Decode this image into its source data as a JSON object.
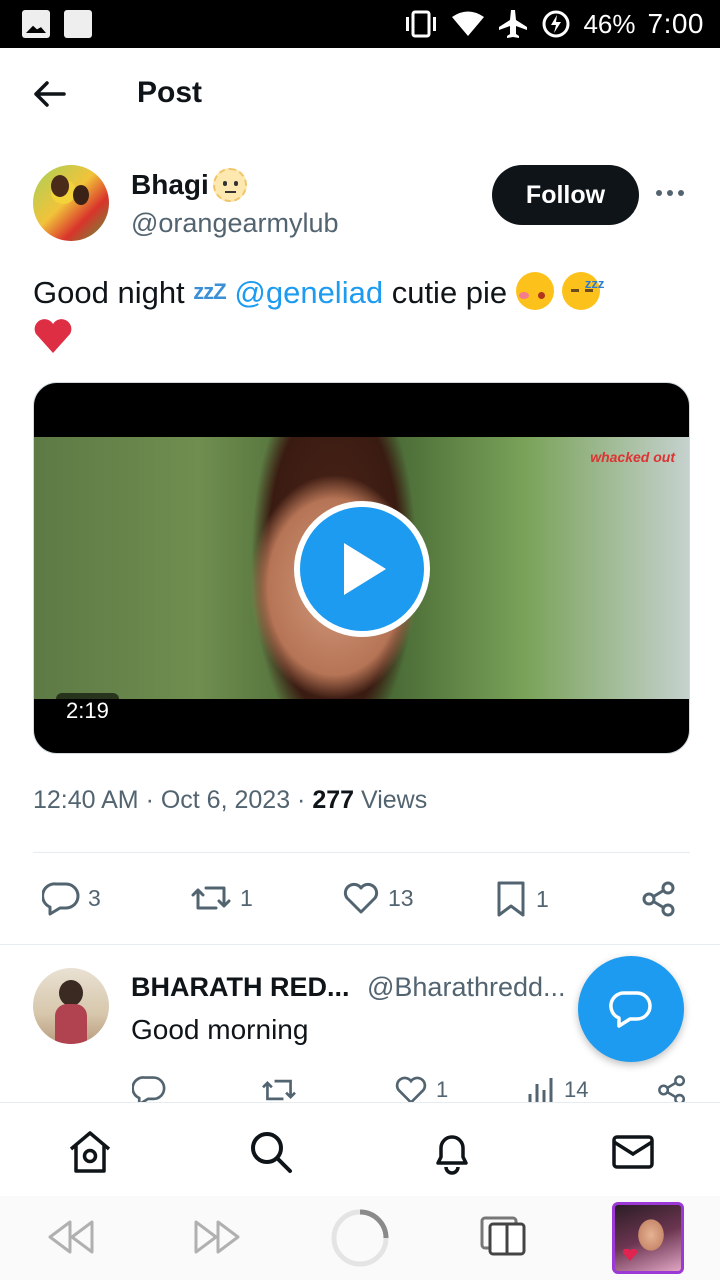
{
  "status_bar": {
    "battery": "46%",
    "time": "7:00"
  },
  "header": {
    "title": "Post"
  },
  "post": {
    "author_name": "Bhagi",
    "author_handle": "@orangearmylub",
    "follow_label": "Follow",
    "text_part1": "Good night",
    "zzz": "zzZ",
    "mention": "@geneliad",
    "text_part2": "cutie pie",
    "video": {
      "duration": "2:19",
      "watermark": "whacked out"
    },
    "timestamp": "12:40 AM · Oct 6, 2023",
    "views_count": "277",
    "views_label": "Views",
    "stats": {
      "replies": "3",
      "reposts": "1",
      "likes": "13",
      "bookmarks": "1"
    }
  },
  "reply": {
    "author_name": "BHARATH RED...",
    "author_handle": "@Bharathredd...",
    "text": "Good morning",
    "stats": {
      "likes": "1",
      "views": "14"
    }
  },
  "colors": {
    "accent": "#1d9bf0",
    "text_primary": "#0f1419",
    "text_secondary": "#536471",
    "heart_red": "#dd2e44"
  }
}
